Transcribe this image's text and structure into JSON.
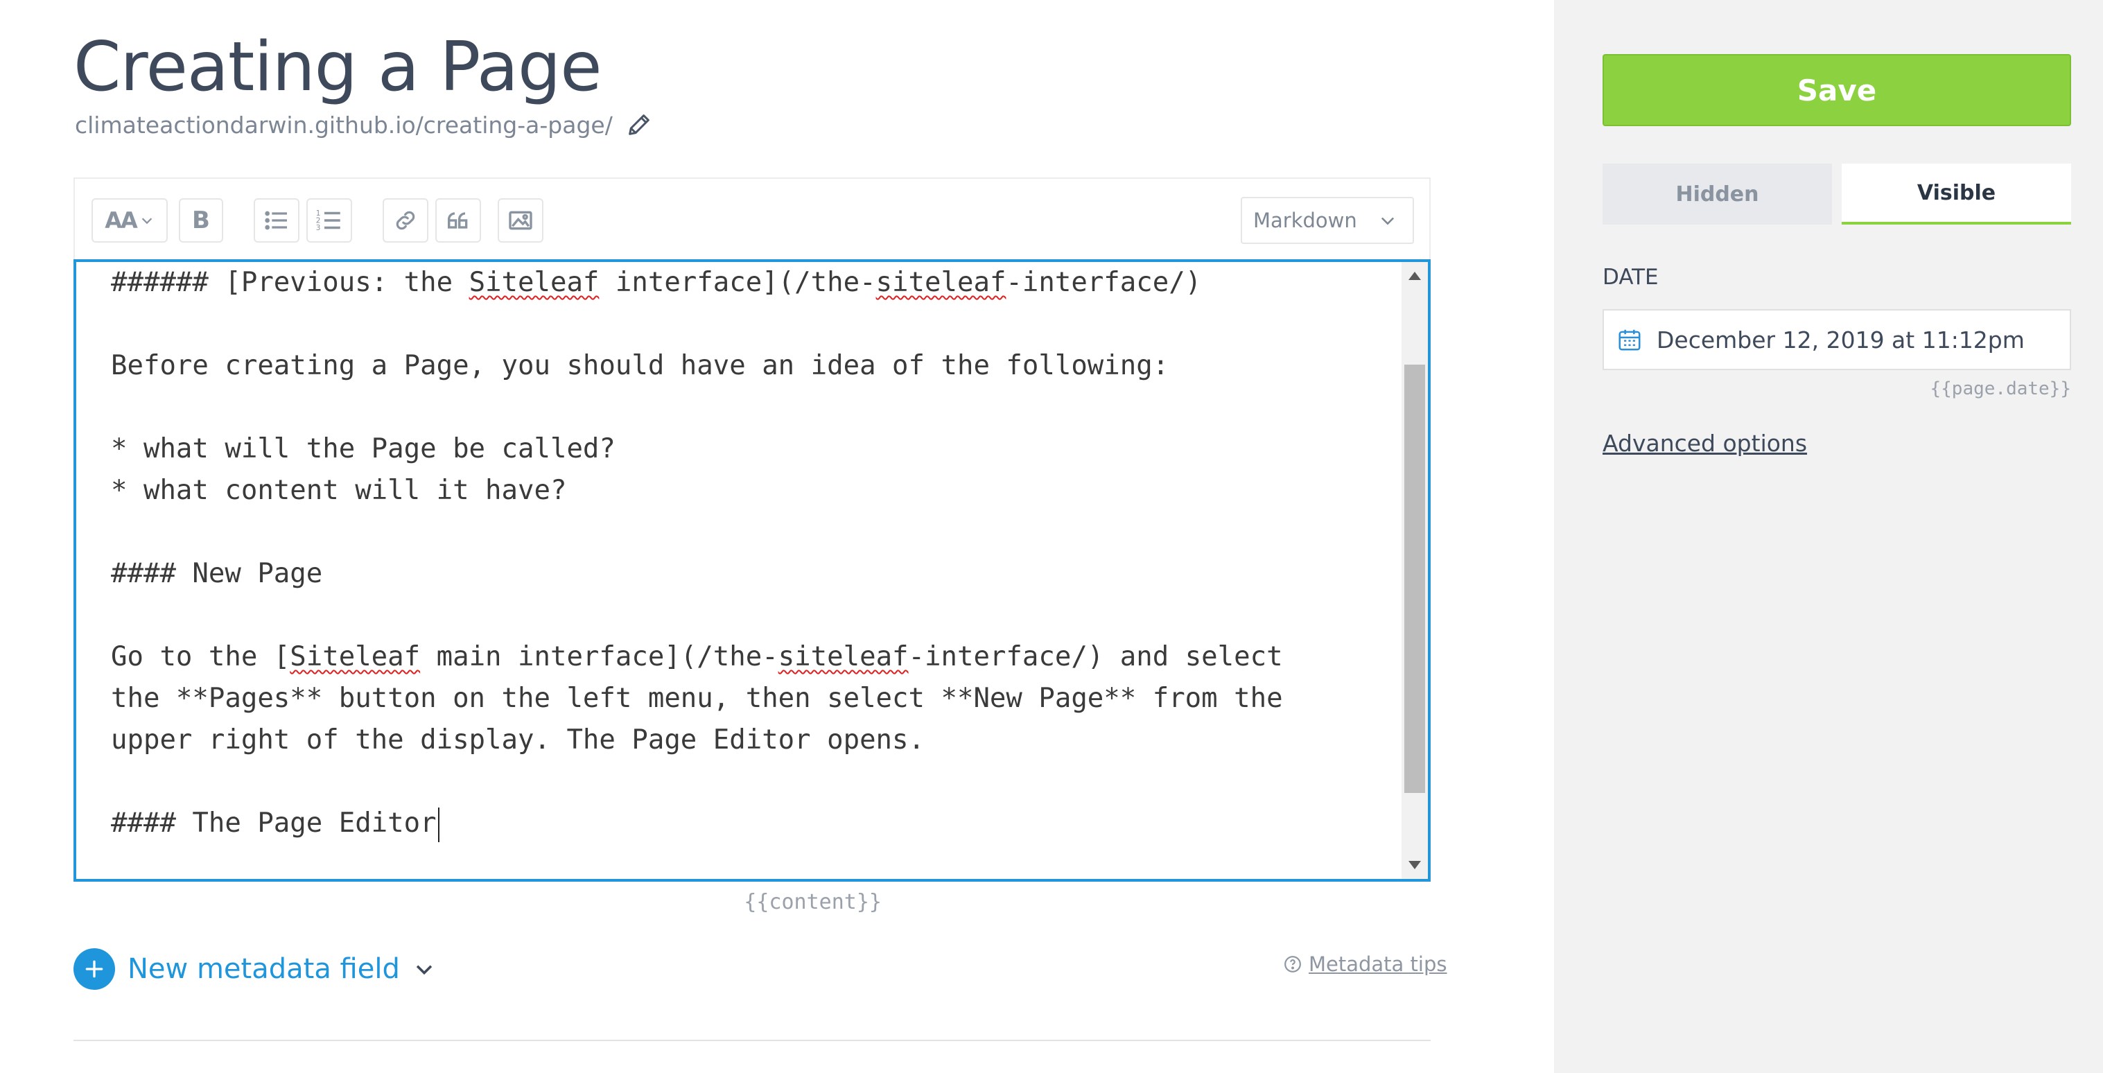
{
  "page": {
    "title": "Creating a Page",
    "url": "climateactiondarwin.github.io/creating-a-page/"
  },
  "toolbar": {
    "format_label": "AA",
    "bold_label": "B",
    "mode_select": "Markdown"
  },
  "editor": {
    "lines": [
      [
        {
          "t": "###### [Previous: the "
        },
        {
          "t": "Siteleaf",
          "spell": true
        },
        {
          "t": " interface](/the-"
        },
        {
          "t": "siteleaf",
          "spell": true
        },
        {
          "t": "-interface/)"
        }
      ],
      [],
      [
        {
          "t": "Before creating a Page, you should have an idea of the following:"
        }
      ],
      [],
      [
        {
          "t": "* what will the Page be called?"
        }
      ],
      [
        {
          "t": "* what content will it have?"
        }
      ],
      [],
      [
        {
          "t": "#### New Page"
        }
      ],
      [],
      [
        {
          "t": "Go to the ["
        },
        {
          "t": "Siteleaf",
          "spell": true
        },
        {
          "t": " main interface](/the-"
        },
        {
          "t": "siteleaf",
          "spell": true
        },
        {
          "t": "-interface/) and select"
        }
      ],
      [
        {
          "t": "the **Pages** button on the left menu, then select **New Page** from the"
        }
      ],
      [
        {
          "t": "upper right of the display. The Page Editor opens."
        }
      ],
      [],
      [
        {
          "t": "#### The Page Editor",
          "caret": true
        }
      ]
    ],
    "content_tag": "{{content}}"
  },
  "metadata": {
    "new_field_label": "New metadata field",
    "tips_label": "Metadata tips"
  },
  "sidebar": {
    "save_label": "Save",
    "hidden_label": "Hidden",
    "visible_label": "Visible",
    "selected_visibility": "Visible",
    "date_label": "DATE",
    "date_value": "December 12, 2019 at 11:12pm",
    "date_tag": "{{page.date}}",
    "advanced_label": "Advanced options"
  },
  "colors": {
    "accent_blue": "#1f95db",
    "save_green": "#8cd13f",
    "spellcheck_red": "#e02020"
  },
  "icons": [
    "pencil-icon",
    "text-size-icon",
    "chevron-down-icon",
    "bold-icon",
    "bullet-list-icon",
    "numbered-list-icon",
    "link-icon",
    "quote-icon",
    "image-icon",
    "plus-icon",
    "help-circle-icon",
    "calendar-icon"
  ]
}
